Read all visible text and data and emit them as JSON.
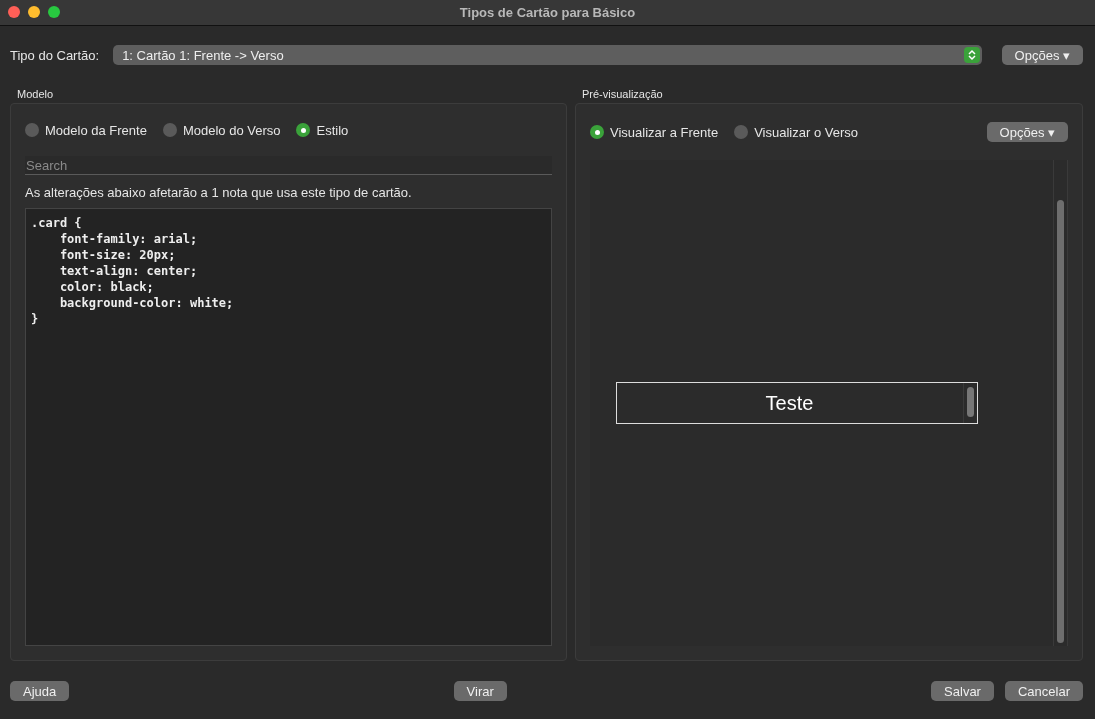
{
  "window": {
    "title": "Tipos de Cartão para Básico"
  },
  "card_type": {
    "label": "Tipo do Cartão:",
    "value": "1: Cartão 1: Frente -> Verso",
    "options_button": "Opções ▾"
  },
  "template_panel": {
    "title": "Modelo",
    "radios": [
      {
        "label": "Modelo da Frente",
        "selected": false
      },
      {
        "label": "Modelo do Verso",
        "selected": false
      },
      {
        "label": "Estilo",
        "selected": true
      }
    ],
    "search": {
      "placeholder": "Search"
    },
    "notice": "As alterações abaixo afetarão a 1 nota que usa este tipo de cartão.",
    "code": ".card {\n    font-family: arial;\n    font-size: 20px;\n    text-align: center;\n    color: black;\n    background-color: white;\n}"
  },
  "preview_panel": {
    "title": "Pré-visualização",
    "radios": [
      {
        "label": "Visualizar a Frente",
        "selected": true
      },
      {
        "label": "Visualizar o Verso",
        "selected": false
      }
    ],
    "options_button": "Opções ▾",
    "card_text": "Teste"
  },
  "buttons": {
    "left": "Ajuda",
    "center": "Virar",
    "right": [
      "Salvar",
      "Cancelar"
    ]
  }
}
